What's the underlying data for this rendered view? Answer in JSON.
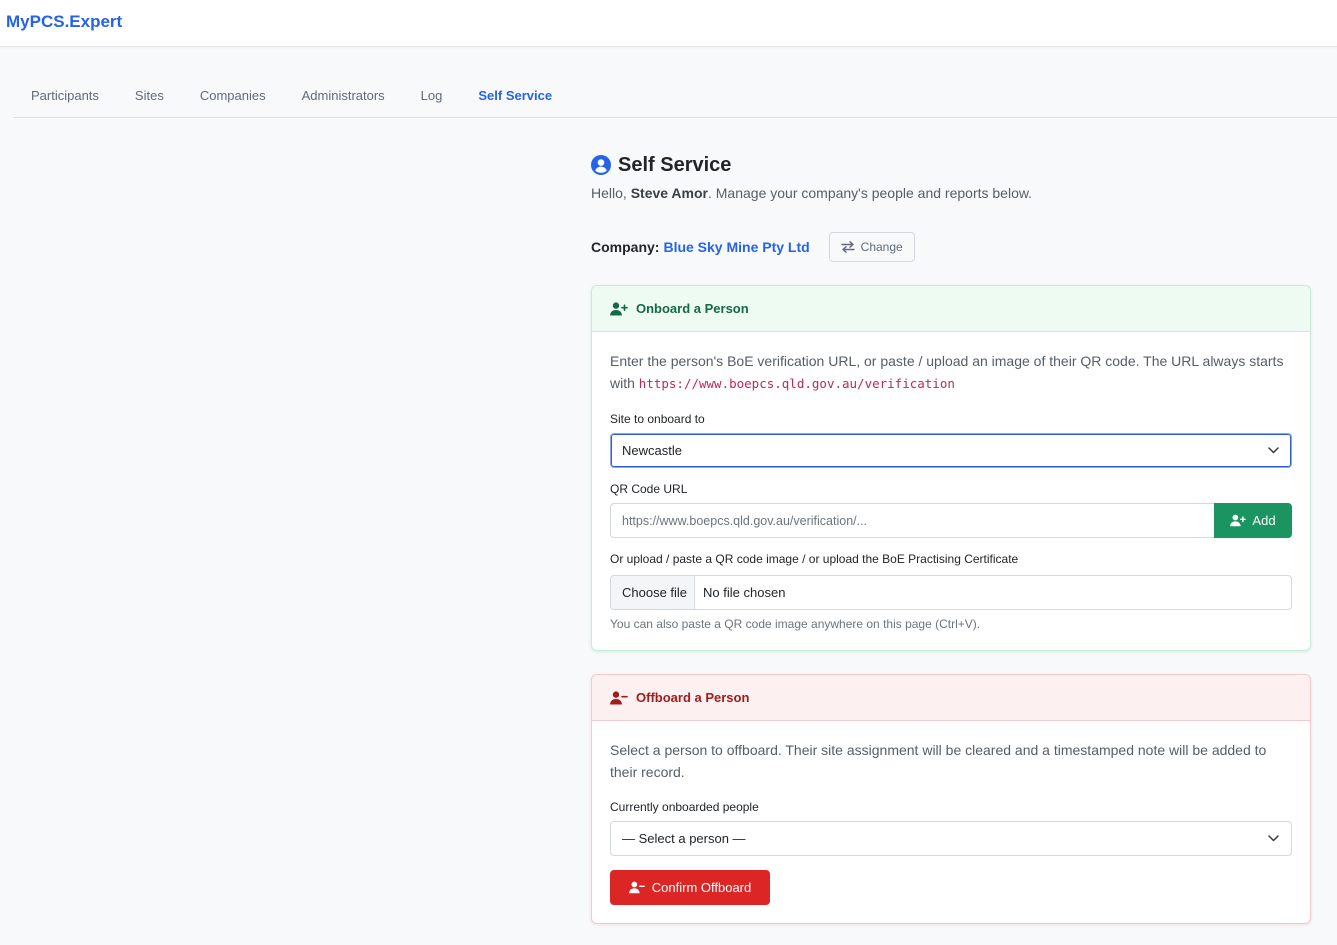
{
  "app": {
    "brand": "MyPCS.Expert"
  },
  "nav": {
    "items": [
      {
        "label": "Participants"
      },
      {
        "label": "Sites"
      },
      {
        "label": "Companies"
      },
      {
        "label": "Administrators"
      },
      {
        "label": "Log"
      },
      {
        "label": "Self Service",
        "active": true
      }
    ]
  },
  "page": {
    "title": "Self Service",
    "greeting_prefix": "Hello, ",
    "user_name": "Steve Amor",
    "greeting_suffix": ". Manage your company's people and reports below.",
    "company_label": "Company:",
    "company_name": "Blue Sky Mine Pty Ltd",
    "change_label": "Change"
  },
  "onboard": {
    "header": "Onboard a Person",
    "desc_text": "Enter the person's BoE verification URL, or paste / upload an image of their QR code. The URL always starts with ",
    "desc_code": "https://www.boepcs.qld.gov.au/verification",
    "site_label": "Site to onboard to",
    "site_value": "Newcastle",
    "qr_label": "QR Code URL",
    "qr_placeholder": "https://www.boepcs.qld.gov.au/verification/...",
    "add_label": "Add",
    "upload_label": "Or upload / paste a QR code image / or upload the BoE Practising Certificate",
    "file_button": "Choose file",
    "file_status": "No file chosen",
    "hint": "You can also paste a QR code image anywhere on this page (Ctrl+V)."
  },
  "offboard": {
    "header": "Offboard a Person",
    "desc": "Select a person to offboard. Their site assignment will be cleared and a timestamped note will be added to their record.",
    "people_label": "Currently onboarded people",
    "people_value": "— Select a person —",
    "confirm_label": "Confirm Offboard"
  },
  "colors": {
    "accent": "#2563eb",
    "success": "#1a9460",
    "danger": "#dc2626"
  },
  "icons": {
    "title": "user-circle-icon",
    "change": "swap-arrows-icon",
    "onboard": "user-plus-icon",
    "offboard": "user-minus-icon",
    "dropdown": "chevron-down-icon"
  }
}
